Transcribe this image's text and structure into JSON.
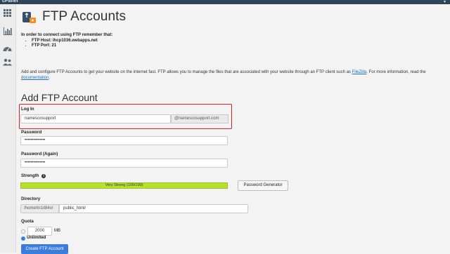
{
  "topbar": {
    "brand": "cPanel"
  },
  "sidebar": {
    "items": [
      "home-grid-icon",
      "stats-chart-icon",
      "dashboard-gauge-icon",
      "users-icon"
    ]
  },
  "page": {
    "title": "FTP Accounts"
  },
  "note": {
    "heading": "In order to connect using FTP remember that:",
    "host": "FTP Host: lhcp1036.webapps.net",
    "port": "FTP Port: 21"
  },
  "description": {
    "text_before": "Add and configure FTP Accounts to get your website on the internet fast. FTP allows you to manage the files that are associated with your website through an FTP client such as ",
    "link_filezilla": "FileZilla",
    "text_middle": ". For more information, read the ",
    "link_docs": "documentation",
    "text_after": "."
  },
  "form": {
    "section_title": "Add FTP Account",
    "login_label": "Log In",
    "login_value": "namescosupport",
    "domain_suffix": "@namescosupport.com",
    "password_label": "Password",
    "password_value": "••••••••••••••",
    "password_again_label": "Password (Again)",
    "password_again_value": "••••••••••••••",
    "strength_label": "Strength",
    "strength_text": "Very Strong (100/100)",
    "strength_percent": 100,
    "password_generator": "Password Generator",
    "directory_label": "Directory",
    "directory_prefix": "/home/tn1rl84v/",
    "directory_value": "public_html/",
    "quota_label": "Quota",
    "quota_value": "2000",
    "quota_unit": "MB",
    "unlimited_label": "Unlimited",
    "create_button": "Create FTP Account"
  },
  "colors": {
    "accent": "#3b7ddd",
    "highlight_border": "#d8222a",
    "strength_bar": "#b6e22e"
  }
}
